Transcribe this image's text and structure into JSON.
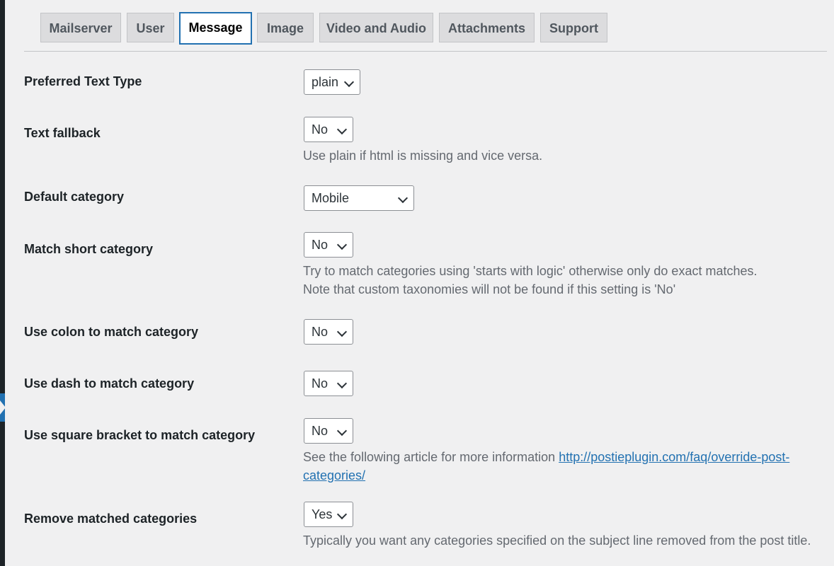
{
  "tabs": [
    {
      "label": "Mailserver",
      "active": false
    },
    {
      "label": "User",
      "active": false
    },
    {
      "label": "Message",
      "active": true
    },
    {
      "label": "Image",
      "active": false
    },
    {
      "label": "Video and Audio",
      "active": false
    },
    {
      "label": "Attachments",
      "active": false
    },
    {
      "label": "Support",
      "active": false
    }
  ],
  "settings": {
    "preferred_text_type": {
      "label": "Preferred Text Type",
      "value": "plain"
    },
    "text_fallback": {
      "label": "Text fallback",
      "value": "No",
      "description": "Use plain if html is missing and vice versa."
    },
    "default_category": {
      "label": "Default category",
      "value": "Mobile"
    },
    "match_short_category": {
      "label": "Match short category",
      "value": "No",
      "description_line1": "Try to match categories using 'starts with logic' otherwise only do exact matches.",
      "description_line2": "Note that custom taxonomies will not be found if this setting is 'No'"
    },
    "use_colon": {
      "label": "Use colon to match category",
      "value": "No"
    },
    "use_dash": {
      "label": "Use dash to match category",
      "value": "No"
    },
    "use_square_bracket": {
      "label": "Use square bracket to match category",
      "value": "No",
      "description_prefix": "See the following article for more information",
      "link_line1": "http://postieplugin.com/faq/override-post-",
      "link_line2": "categories/"
    },
    "remove_matched": {
      "label": "Remove matched categories",
      "value": "Yes",
      "description": "Typically you want any categories specified on the subject line removed from the post title."
    }
  },
  "colors": {
    "accent": "#2271b1",
    "background": "#f0f0f1",
    "tab_inactive": "#dcdcde",
    "description_text": "#646970"
  },
  "icons": {
    "select_arrow": "chevron-down-icon"
  }
}
